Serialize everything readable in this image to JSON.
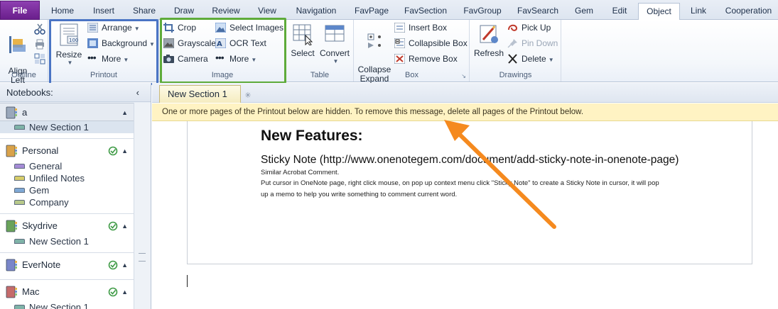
{
  "tabs": {
    "file": "File",
    "items": [
      "Home",
      "Insert",
      "Share",
      "Draw",
      "Review",
      "View",
      "Navigation",
      "FavPage",
      "FavSection",
      "FavGroup",
      "FavSearch",
      "Gem",
      "Edit",
      "Object",
      "Link",
      "Cooperation"
    ],
    "active": "Object"
  },
  "ribbon": {
    "outline": {
      "label": "Outline",
      "align_left": "Align\nLeft"
    },
    "printout": {
      "label": "Printout",
      "resize": "Resize",
      "arrange": "Arrange",
      "background": "Background",
      "more": "More"
    },
    "image": {
      "label": "Image",
      "crop": "Crop",
      "grayscale": "Grayscale",
      "camera": "Camera",
      "select_images": "Select Images",
      "ocr_text": "OCR Text",
      "more": "More"
    },
    "table": {
      "label": "Table",
      "select": "Select",
      "convert": "Convert"
    },
    "box": {
      "label": "Box",
      "collapse_expand": "Collapse\nExpand",
      "insert_box": "Insert Box",
      "collapsible_box": "Collapsible Box",
      "remove_box": "Remove Box"
    },
    "drawings": {
      "label": "Drawings",
      "refresh": "Refresh",
      "pick_up": "Pick Up",
      "pin_down": "Pin Down",
      "delete": "Delete"
    }
  },
  "sidebar": {
    "title": "Notebooks:",
    "notebooks": [
      {
        "name": "a",
        "color": "#9aa8bb",
        "sections": [
          {
            "name": "New Section 1",
            "color": "#7fb3a8",
            "selected": true
          }
        ]
      },
      {
        "name": "Personal",
        "color": "#d9a24a",
        "sync": true,
        "sections": [
          {
            "name": "General",
            "color": "#a58bd6"
          },
          {
            "name": "Unfiled Notes",
            "color": "#d7cd6a"
          },
          {
            "name": "Gem",
            "color": "#7fa9d6"
          },
          {
            "name": "Company",
            "color": "#b8c98a"
          }
        ]
      },
      {
        "name": "Skydrive",
        "color": "#6aa35a",
        "sync": true,
        "sections": [
          {
            "name": "New Section 1",
            "color": "#7fb3a8"
          }
        ]
      },
      {
        "name": "EverNote",
        "color": "#7a86c9",
        "sync": true,
        "sections": []
      },
      {
        "name": "Mac",
        "color": "#c56b6b",
        "sync": true,
        "sections": [
          {
            "name": "New Section 1",
            "color": "#7fb3a8"
          }
        ]
      }
    ]
  },
  "section_tab": "New Section 1",
  "message": "One or more pages of the Printout below are hidden. To remove this message, delete all pages of the Printout below.",
  "page": {
    "heading": "New Features:",
    "sticky_title": "Sticky Note (http://www.onenotegem.com/document/add-sticky-note-in-onenote-page)",
    "line1": "Similar Acrobat Comment.",
    "line2": "Put cursor in OneNote page, right click mouse, on pop up context menu click \"Sticky Note\" to create a Sticky Note in cursor, it will pop",
    "line3": "up a memo to help you write something to comment current word."
  },
  "colors": {
    "file_tab": "#7a2ca0",
    "printout_highlight": "#4a74c4",
    "image_highlight": "#5eab3a",
    "arrow": "#f58a1f",
    "message_bg": "#fff3c3"
  }
}
